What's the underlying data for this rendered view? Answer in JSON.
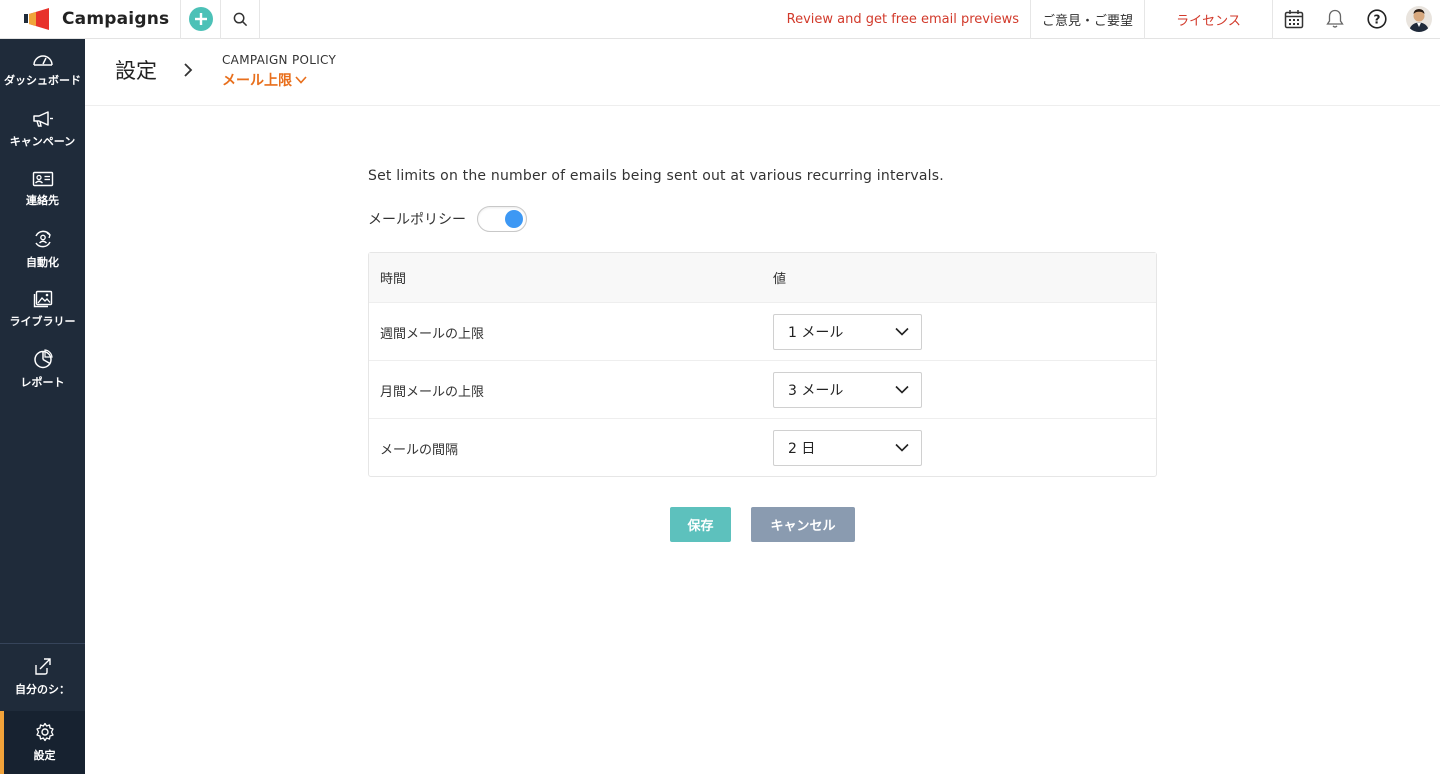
{
  "brand": {
    "name": "Campaigns"
  },
  "topbar": {
    "review_link": "Review and get free email previews",
    "feedback_link": "ご意見・ご要望",
    "license_link": "ライセンス"
  },
  "sidebar": {
    "items": [
      {
        "label": "ダッシュボード",
        "icon": "dashboard-icon"
      },
      {
        "label": "キャンペーン",
        "icon": "megaphone-icon"
      },
      {
        "label": "連絡先",
        "icon": "contact-card-icon"
      },
      {
        "label": "自動化",
        "icon": "automation-icon"
      },
      {
        "label": "ライブラリー",
        "icon": "image-library-icon"
      },
      {
        "label": "レポート",
        "icon": "pie-chart-icon"
      }
    ],
    "mine_label": "自分のシ：",
    "settings_label": "設定"
  },
  "header": {
    "title": "設定",
    "breadcrumb_parent": "CAMPAIGN POLICY",
    "breadcrumb_current": "メール上限"
  },
  "content": {
    "description": "Set limits on the number of emails being sent out at various recurring intervals.",
    "policy_label": "メールポリシー",
    "policy_enabled": true,
    "table": {
      "headers": [
        "時間",
        "値"
      ],
      "rows": [
        {
          "label": "週間メールの上限",
          "value": "1 メール"
        },
        {
          "label": "月間メールの上限",
          "value": "3 メール"
        },
        {
          "label": "メールの間隔",
          "value": "2 日"
        }
      ]
    },
    "save_label": "保存",
    "cancel_label": "キャンセル"
  },
  "colors": {
    "accent_orange": "#e86f1c",
    "link_red": "#d23a2b",
    "toggle_on": "#3d98f4",
    "save_button": "#5dc1bd",
    "cancel_button": "#8a9bb0",
    "sidebar_bg": "#1f2b3a"
  }
}
